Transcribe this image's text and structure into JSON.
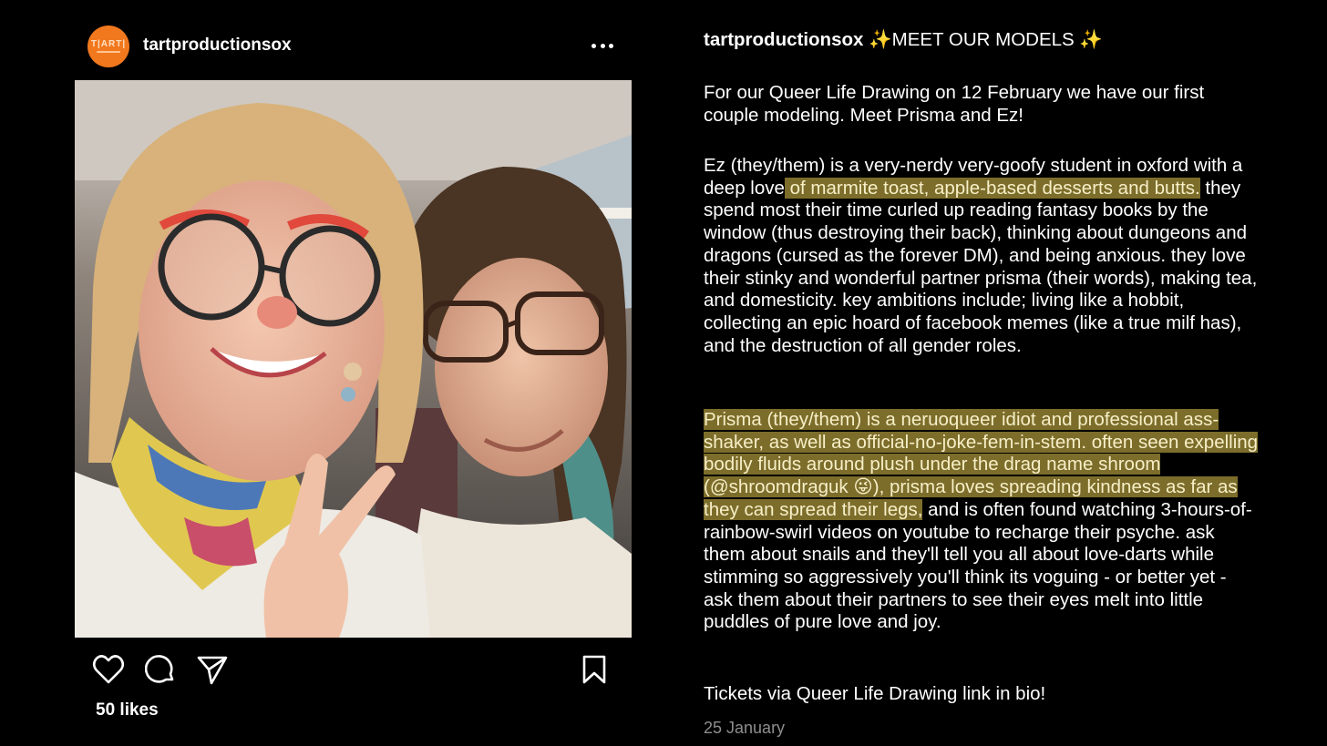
{
  "post": {
    "username": "tartproductionsox",
    "avatar_text": "T|ART|",
    "likes": "50 likes",
    "icons": {
      "more": "more-horizontal-icon",
      "like": "heart-icon",
      "comment": "comment-icon",
      "share": "send-icon",
      "save": "bookmark-icon"
    }
  },
  "caption": {
    "username": "tartproductionsox",
    "headline": " ✨MEET OUR MODELS ✨",
    "intro": "For our Queer Life Drawing on 12 February we have our first couple modeling. Meet Prisma and Ez!",
    "ez_a": "Ez (they/them) is a very-nerdy very-goofy student in oxford with a deep love",
    "ez_highlight": " of marmite toast, apple-based desserts and butts.",
    "ez_b": " they spend most their time curled up reading fantasy books by the window (thus destroying their back), thinking about dungeons and dragons (cursed as the forever DM), and being anxious. they love their stinky and wonderful partner prisma (their words), making tea, and domesticity. key ambitions include; living like a hobbit, collecting an epic hoard of facebook memes (like a true milf has), and the destruction of all gender roles.",
    "prisma_highlight": "Prisma (they/them) is a neruoqueer idiot and professional ass-shaker, as well as official-no-joke-fem-in-stem. often seen expelling bodily fluids around plush under the drag name shroom (@shroomdraguk 😜), prisma loves spreading kindness as far as they can spread their legs,",
    "prisma_b": " and is often found watching 3-hours-of-rainbow-swirl videos on youtube to recharge their psyche. ask them about snails and they'll tell you all about love-darts while stimming so aggressively you'll think its voguing - or better yet - ask them about their partners to see their eyes melt into little puddles of pure love and joy.",
    "tickets": "Tickets via Queer Life Drawing link in bio!",
    "date": "25 January"
  },
  "colors": {
    "background": "#000000",
    "highlight": "#7c6d2b",
    "avatar": "#f2781e",
    "date": "#8e8e8e"
  }
}
